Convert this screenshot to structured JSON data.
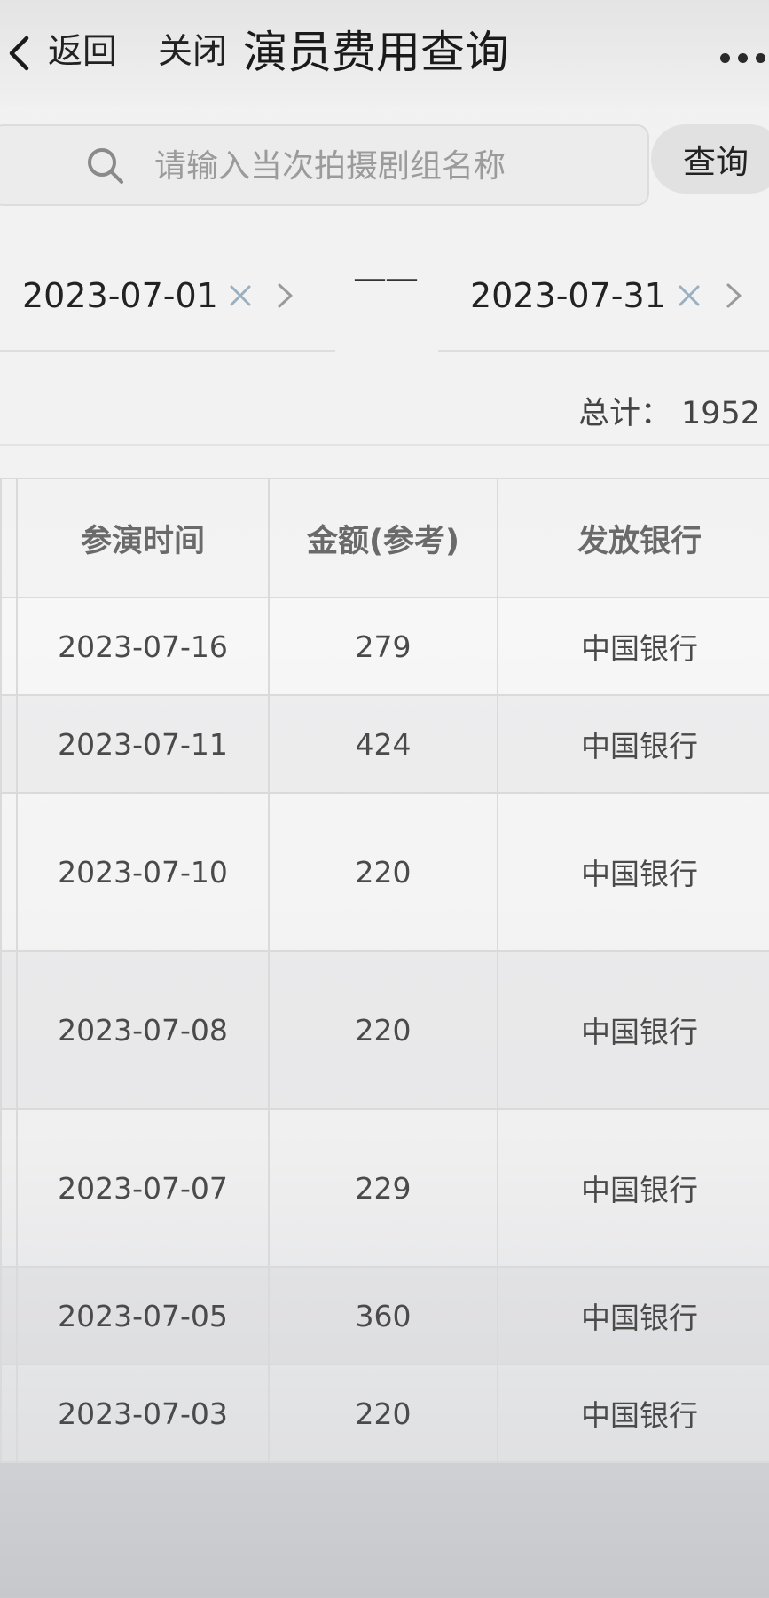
{
  "nav": {
    "back_label": "返回",
    "close_label": "关闭",
    "title": "演员费用查询"
  },
  "search": {
    "placeholder": "请输入当次拍摄剧组名称",
    "value": "",
    "button_label": "查询"
  },
  "date_range": {
    "start": "2023-07-01",
    "end": "2023-07-31",
    "separator": "——"
  },
  "summary": {
    "total_label": "总计：",
    "total_value": "1952"
  },
  "table": {
    "headers": [
      "参演时间",
      "金额(参考)",
      "发放银行"
    ],
    "rows": [
      {
        "date": "2023-07-16",
        "amount": "279",
        "bank": "中国银行"
      },
      {
        "date": "2023-07-11",
        "amount": "424",
        "bank": "中国银行"
      },
      {
        "date": "2023-07-10",
        "amount": "220",
        "bank": "中国银行"
      },
      {
        "date": "2023-07-08",
        "amount": "220",
        "bank": "中国银行"
      },
      {
        "date": "2023-07-07",
        "amount": "229",
        "bank": "中国银行"
      },
      {
        "date": "2023-07-05",
        "amount": "360",
        "bank": "中国银行"
      },
      {
        "date": "2023-07-03",
        "amount": "220",
        "bank": "中国银行"
      }
    ]
  },
  "icons": {
    "back": "chevron-left-icon",
    "more": "more-dots-icon",
    "search": "search-icon",
    "clear": "close-icon",
    "next": "chevron-right-icon"
  }
}
